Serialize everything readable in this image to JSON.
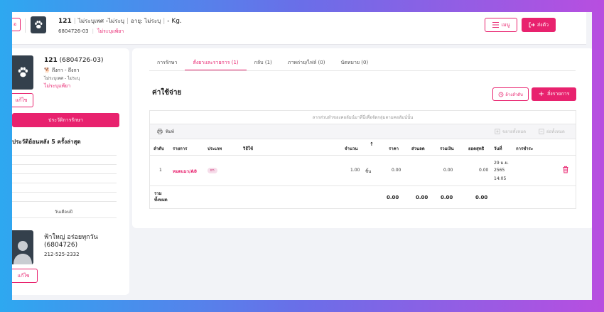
{
  "header": {
    "back_label": "อ",
    "pet_name": "121",
    "pet_gender": "ไม่ระบุเพศ",
    "pet_sterile": "ไม่ระบุ",
    "pet_age": "อายุ: ไม่ระบุ",
    "pet_weight": "- Kg.",
    "pet_id": "6804726-03",
    "pet_allergy": "ไม่ระบุแพ้ยา",
    "menu_label": "เมนู",
    "send_label": "ส่งตัว"
  },
  "pet_card": {
    "name": "121",
    "id": "(6804726-03)",
    "breed": "ถึงกา - ถึงกา",
    "gender_info": "ไม่ระบุเพศ - ไม่ระบุ",
    "allergy": "ไม่ระบุแพ้ยา",
    "edit_label": "แก้ไข",
    "history_button": "ประวัติการรักษา",
    "history_title": "ประวัติย้อนหลัง 5 ครั้งล่าสุด",
    "dob_label": "วันเดือนปี"
  },
  "owner_card": {
    "name": "ฟ้าใหญ่ อร่อยทุกวัน",
    "id": "(6804726)",
    "phone": "212-525-2332",
    "edit_label": "แก้ไข"
  },
  "tabs": [
    {
      "label": "การรักษา",
      "active": false
    },
    {
      "label": "สั่งยาและรายการ (1)",
      "active": true
    },
    {
      "label": "กลับ (1)",
      "active": false
    },
    {
      "label": "ภาพถ่าย/ไฟล์ (0)",
      "active": false
    },
    {
      "label": "นัดหมาย (0)",
      "active": false
    }
  ],
  "expenses": {
    "title": "ค่าใช้จ่าย",
    "reorder_label": "ล้างลำดับ",
    "order_label": "สั่งรายการ",
    "drag_hint": "ลากส่วนหัวของคอลัมน์มาที่นี่เพื่อจัดกลุ่มตามคอลัมน์นั้น",
    "print_label": "พิมพ์",
    "expand_label": "ขยายทั้งหมด",
    "collapse_label": "ย่อทั้งหมด",
    "columns": [
      "ลำดับ",
      "รายการ",
      "ประเภท",
      "วิธีใช้",
      "จำนวน",
      "ราคา",
      "ส่วนลด",
      "รวมเงิน",
      "ยอดสุทธิ",
      "วันที่",
      "การชำระ"
    ],
    "rows": [
      {
        "index": "1",
        "item": "หมดแมว/A8",
        "type": "ยา",
        "usage": "",
        "qty": "1.00",
        "unit": "ชิ้น",
        "price": "0.00",
        "discount": "",
        "total": "0.00",
        "net": "0.00",
        "date_day": "29 ม.ย.",
        "date_year": "2565",
        "date_time": "14:05",
        "payment": ""
      }
    ],
    "footer": {
      "label_line1": "รวม",
      "label_line2": "ทั้งหมด",
      "price": "0.00",
      "discount": "0.00",
      "total": "0.00",
      "net": "0.00"
    }
  },
  "colors": {
    "accent": "#e8226e",
    "avatar_bg": "#34404c"
  }
}
